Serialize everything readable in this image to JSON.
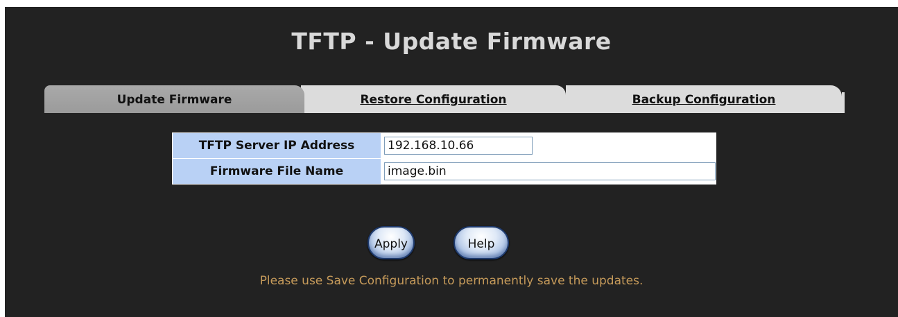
{
  "page": {
    "title": "TFTP - Update Firmware"
  },
  "tabs": [
    {
      "label": "Update Firmware",
      "active": true
    },
    {
      "label": "Restore Configuration",
      "active": false
    },
    {
      "label": "Backup Configuration",
      "active": false
    }
  ],
  "form": {
    "server_ip_label": "TFTP Server IP Address",
    "server_ip_value": "192.168.10.66",
    "file_name_label": "Firmware File Name",
    "file_name_value": "image.bin"
  },
  "buttons": {
    "apply_label": "Apply",
    "help_label": "Help"
  },
  "note": "Please use Save Configuration to permanently save the updates.",
  "colors": {
    "background": "#222222",
    "title": "#d9d9d9",
    "active_tab": "#a0a0a0",
    "inactive_tab": "#dcdcdc",
    "label_cell": "#b9d1f5",
    "note_text": "#c59a5a"
  }
}
